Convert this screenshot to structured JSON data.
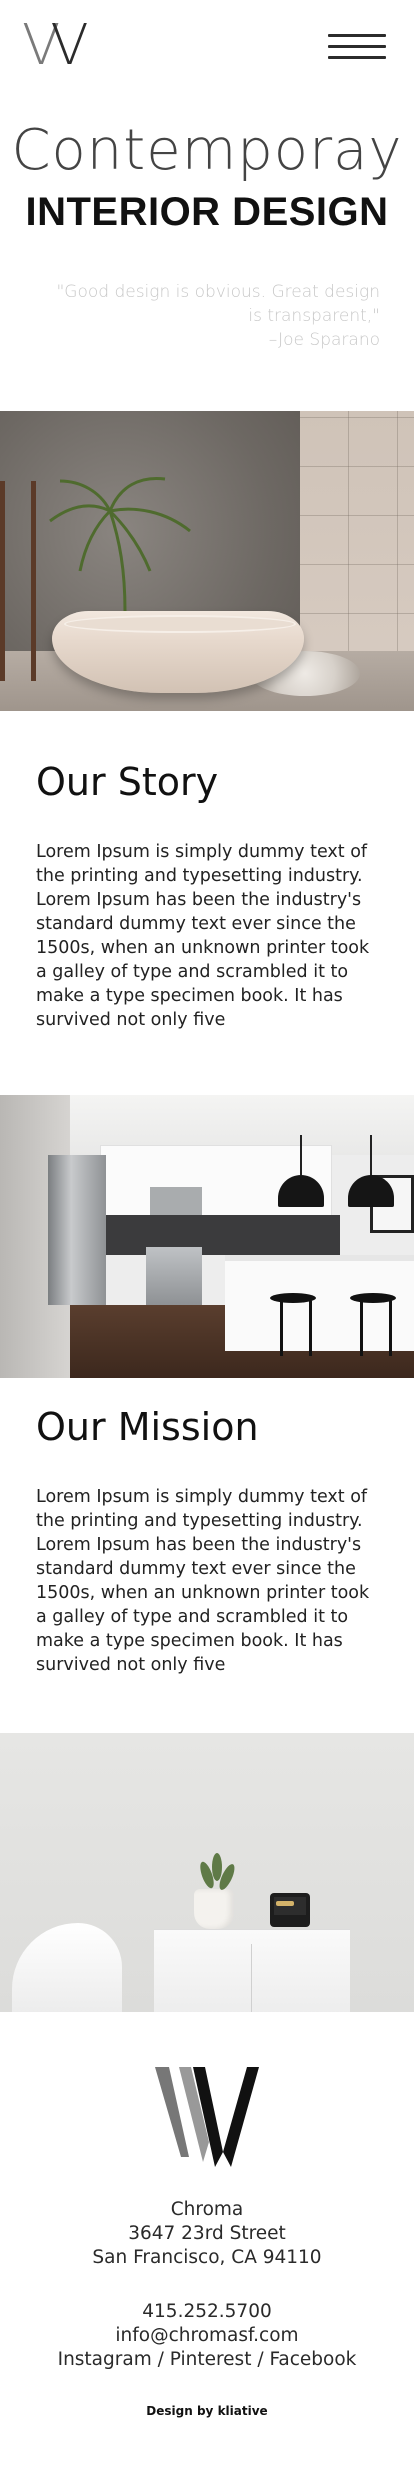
{
  "header": {
    "logo_letter": "W",
    "menu_icon": "hamburger-menu-icon"
  },
  "hero": {
    "line1": "Contemporay",
    "line2": "INTERIOR DESIGN",
    "quote_text": "\"Good design is obvious. Great design is transparent,\"",
    "quote_author": "–Joe Sparano"
  },
  "story": {
    "title": "Our Story",
    "body": "Lorem Ipsum is simply dummy text of the printing and typesetting industry. Lorem Ipsum has been the industry's standard dummy text ever since the 1500s, when an unknown printer took a galley of type and scrambled it to make a type specimen book. It has survived not only five"
  },
  "mission": {
    "title": "Our Mission",
    "body": "Lorem Ipsum is simply dummy text of the printing and typesetting industry. Lorem Ipsum has been the industry's standard dummy text ever since the 1500s, when an unknown printer took a galley of type and scrambled it to make a type specimen book. It has survived not only five"
  },
  "footer": {
    "logo_letter": "W",
    "name": "Chroma",
    "street": "3647 23rd Street",
    "city": "San Francisco, CA 94110",
    "phone": "415.252.5700",
    "email": "info@chromasf.com",
    "social": "Instagram / Pinterest / Facebook",
    "credit_prefix": "Design by",
    "credit_name": "kliative"
  },
  "colors": {
    "text": "#1a1a1a",
    "quote": "#c8c8c8",
    "background": "#ffffff"
  }
}
